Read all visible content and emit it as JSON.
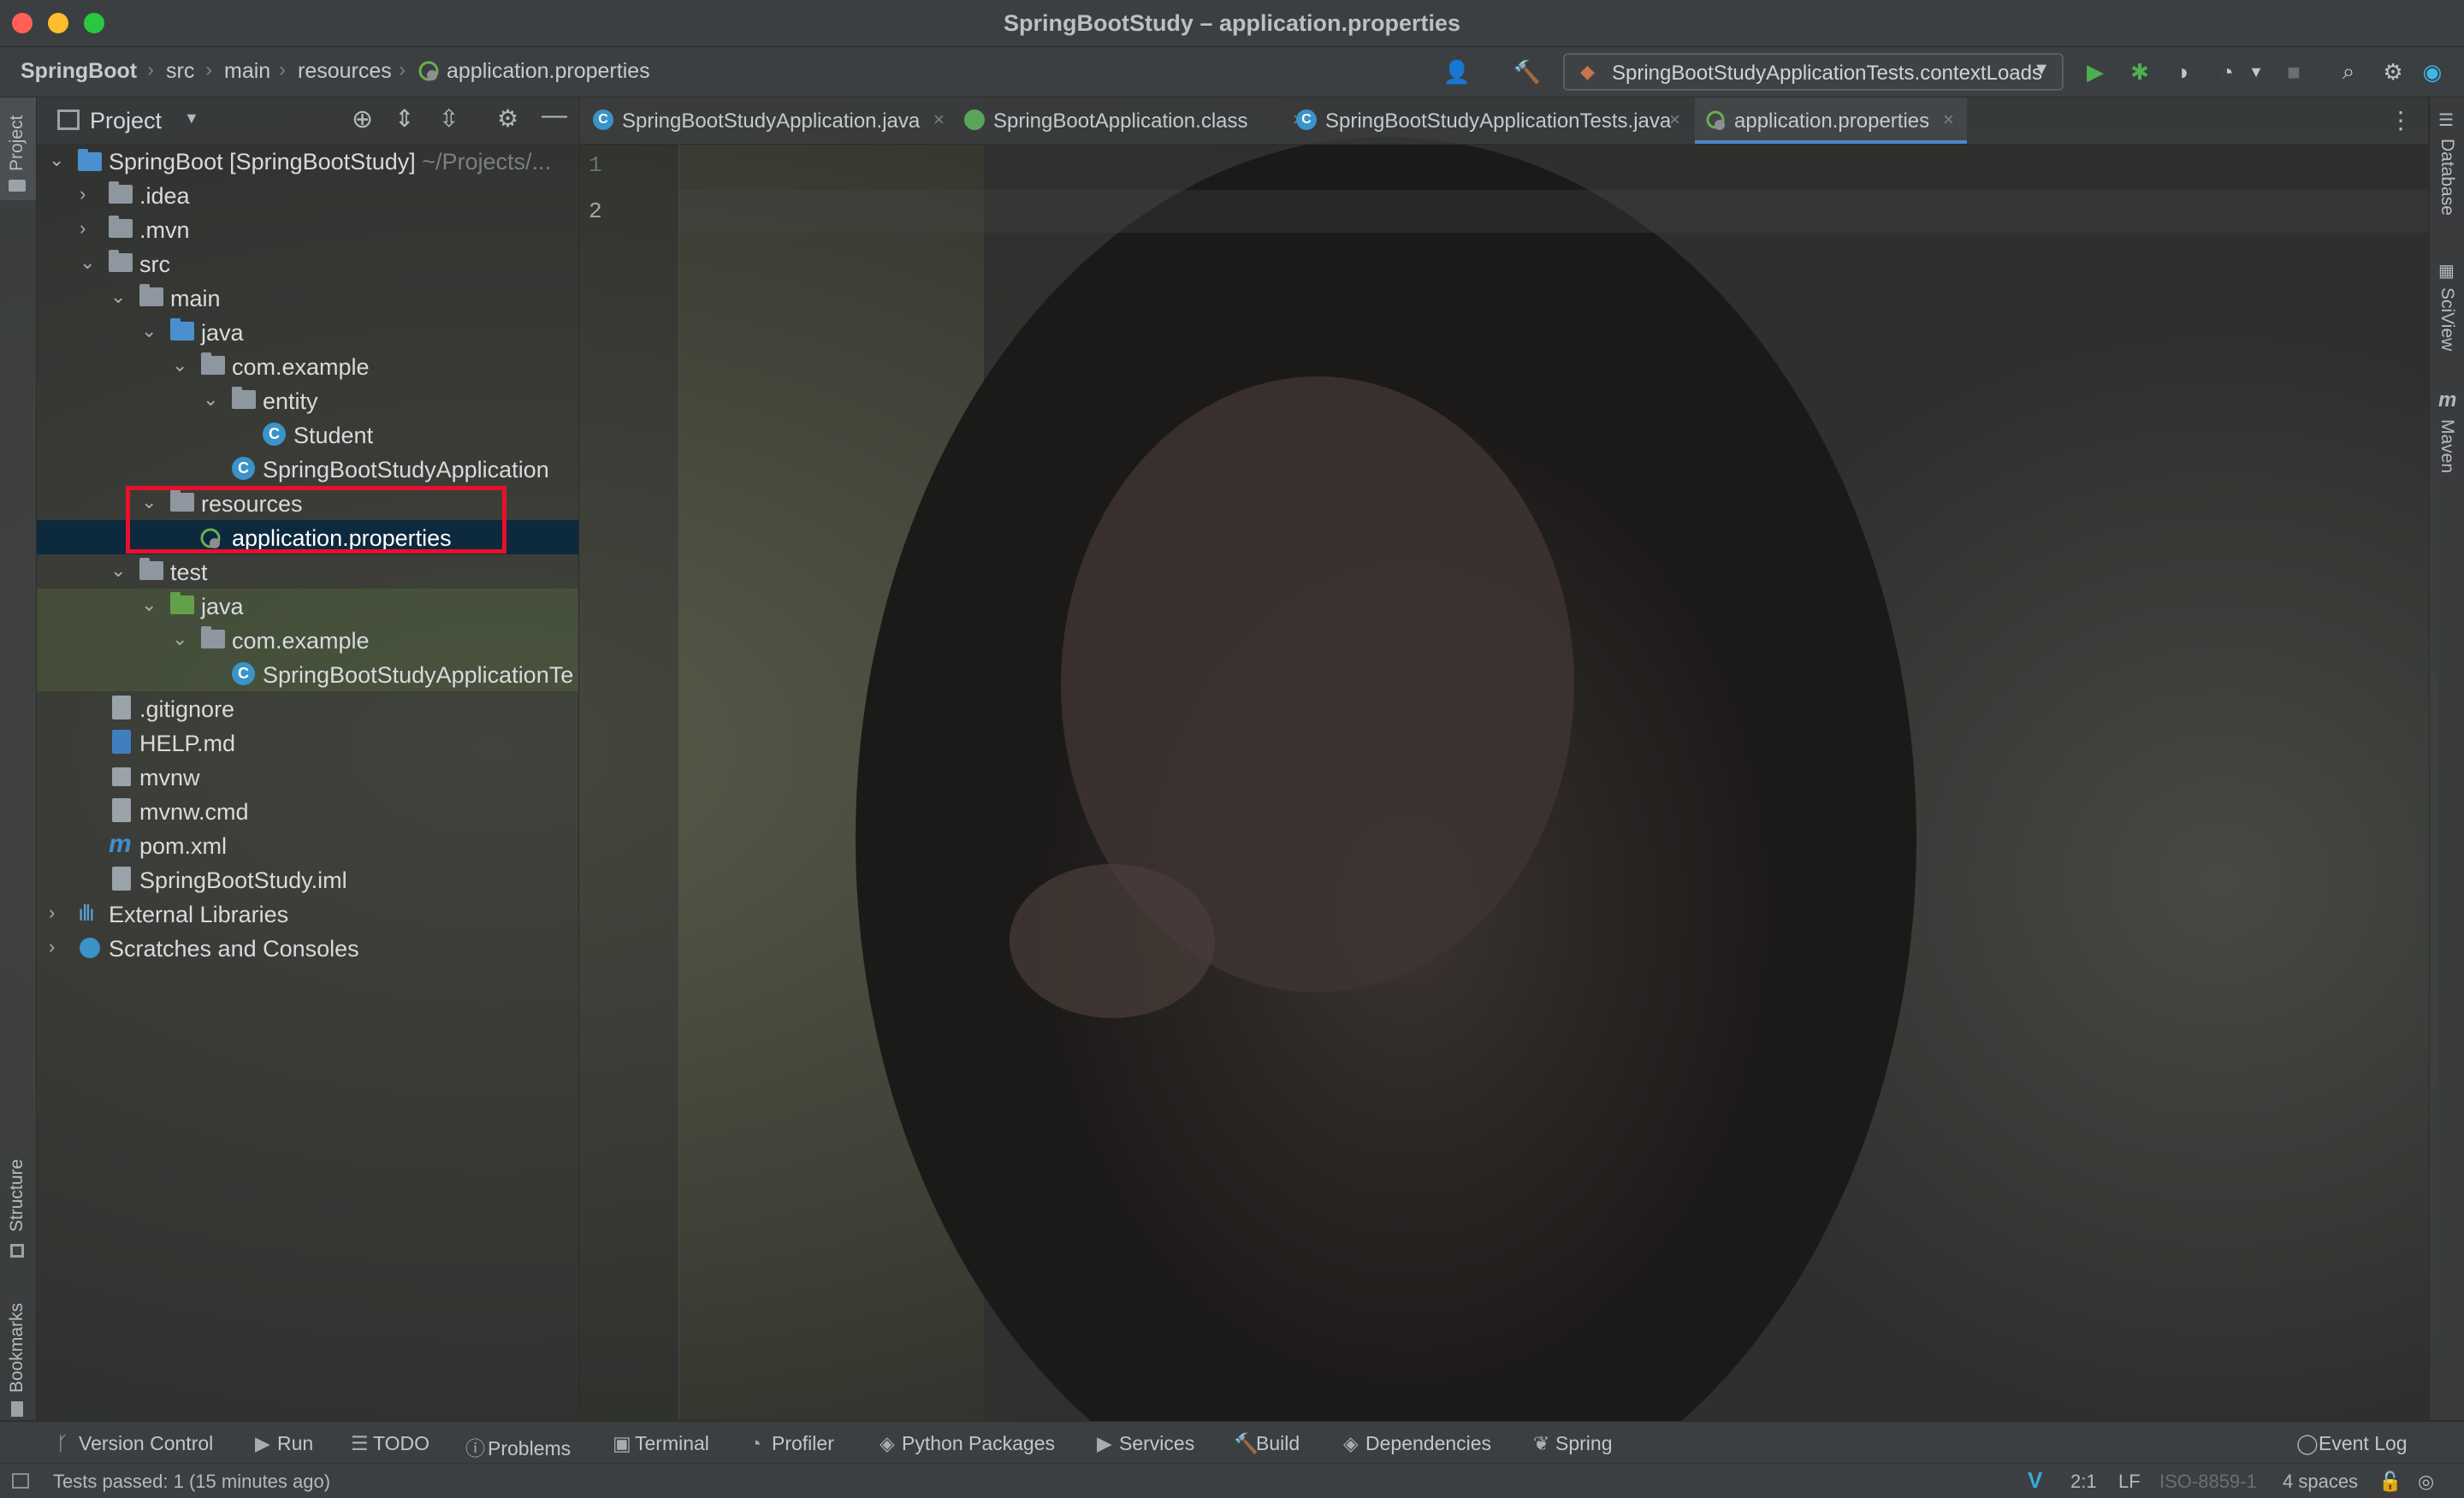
{
  "window": {
    "title": "SpringBootStudy – application.properties"
  },
  "breadcrumb": [
    "SpringBoot",
    "src",
    "main",
    "resources",
    "application.properties"
  ],
  "toolbar": {
    "run_config": "SpringBootStudyApplicationTests.contextLoads"
  },
  "left_strip": {
    "top": "Project",
    "structure": "Structure",
    "bookmarks": "Bookmarks"
  },
  "right_strip": [
    "Database",
    "SciView",
    "Maven"
  ],
  "project_panel": {
    "title": "Project",
    "tree": [
      {
        "label": "SpringBoot [SpringBootStudy]",
        "suffix": "~/Projects/...",
        "depth": 0,
        "expanded": true,
        "icon": "module"
      },
      {
        "label": ".idea",
        "depth": 1,
        "expanded": false,
        "icon": "folder"
      },
      {
        "label": ".mvn",
        "depth": 1,
        "expanded": false,
        "icon": "folder"
      },
      {
        "label": "src",
        "depth": 1,
        "expanded": true,
        "icon": "folder"
      },
      {
        "label": "main",
        "depth": 2,
        "expanded": true,
        "icon": "folder"
      },
      {
        "label": "java",
        "depth": 3,
        "expanded": true,
        "icon": "folder-blue"
      },
      {
        "label": "com.example",
        "depth": 4,
        "expanded": true,
        "icon": "package"
      },
      {
        "label": "entity",
        "depth": 5,
        "expanded": true,
        "icon": "package"
      },
      {
        "label": "Student",
        "depth": 6,
        "icon": "class"
      },
      {
        "label": "SpringBootStudyApplication",
        "depth": 5,
        "icon": "spring-class"
      },
      {
        "label": "resources",
        "depth": 3,
        "expanded": true,
        "icon": "resources"
      },
      {
        "label": "application.properties",
        "depth": 4,
        "icon": "properties",
        "selected": true
      },
      {
        "label": "test",
        "depth": 2,
        "expanded": true,
        "icon": "folder"
      },
      {
        "label": "java",
        "depth": 3,
        "expanded": true,
        "icon": "folder-green"
      },
      {
        "label": "com.example",
        "depth": 4,
        "expanded": true,
        "icon": "package"
      },
      {
        "label": "SpringBootStudyApplicationTe",
        "depth": 5,
        "icon": "spring-class"
      },
      {
        "label": ".gitignore",
        "depth": 1,
        "icon": "file"
      },
      {
        "label": "HELP.md",
        "depth": 1,
        "icon": "md"
      },
      {
        "label": "mvnw",
        "depth": 1,
        "icon": "exec"
      },
      {
        "label": "mvnw.cmd",
        "depth": 1,
        "icon": "file"
      },
      {
        "label": "pom.xml",
        "depth": 1,
        "icon": "maven"
      },
      {
        "label": "SpringBootStudy.iml",
        "depth": 1,
        "icon": "file"
      },
      {
        "label": "External Libraries",
        "depth": 0,
        "expanded": false,
        "icon": "libs"
      },
      {
        "label": "Scratches and Consoles",
        "depth": 0,
        "expanded": false,
        "icon": "scratch"
      }
    ]
  },
  "editor": {
    "tabs": [
      {
        "label": "SpringBootStudyApplication.java",
        "active": false
      },
      {
        "label": "SpringBootApplication.class",
        "active": false
      },
      {
        "label": "SpringBootStudyApplicationTests.java",
        "active": false
      },
      {
        "label": "application.properties",
        "active": true
      }
    ],
    "line_numbers": [
      "1",
      "2"
    ]
  },
  "bottom_tools": [
    "Version Control",
    "Run",
    "TODO",
    "Problems",
    "Terminal",
    "Profiler",
    "Python Packages",
    "Services",
    "Build",
    "Dependencies",
    "Spring"
  ],
  "event_log": "Event Log",
  "status": {
    "message": "Tests passed: 1 (15 minutes ago)",
    "position": "2:1",
    "line_sep": "LF",
    "encoding": "ISO-8859-1",
    "indent": "4 spaces"
  },
  "colors": {
    "accent": "#4a88c7",
    "highlight_box": "#e8102b",
    "selection": "#0d293e",
    "run_green": "#4caf50"
  }
}
